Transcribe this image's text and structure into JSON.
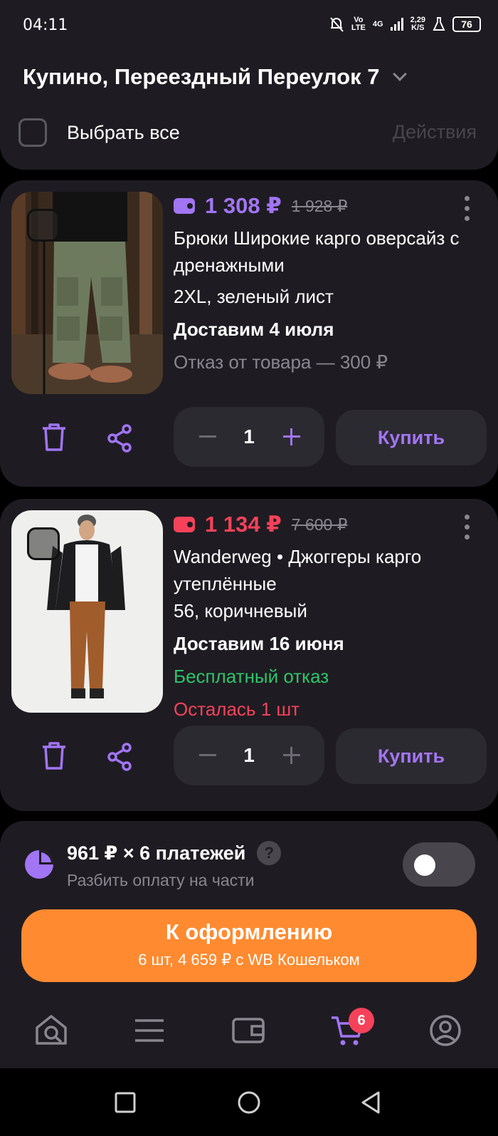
{
  "status_bar": {
    "time": "04:11",
    "network_volte": "Vo\nLTE",
    "network_type": "4G",
    "data_rate": "2,29\nK/S",
    "battery": "76"
  },
  "header": {
    "address": "Купино, Переездный Переулок 7",
    "select_all_label": "Выбрать все",
    "actions_label": "Действия"
  },
  "colors": {
    "wallet_purple": "#a275f4",
    "wallet_red": "#f5425a",
    "checkout_orange": "#ff8a30",
    "free_return_green": "#2fc46a"
  },
  "products": [
    {
      "price": "1 308 ₽",
      "old_price": "1 928 ₽",
      "price_color": "#a275f4",
      "title": "Брюки Широкие карго оверсайз с дренажными",
      "variant": "2XL, зеленый лист",
      "delivery": "Доставим 4 июля",
      "note": "Отказ от товара — 300 ₽",
      "quantity": "1",
      "buy_label": "Купить"
    },
    {
      "price": "1 134 ₽",
      "old_price": "7 600 ₽",
      "price_color": "#f5425a",
      "title": "Wanderweg • Джоггеры карго утеплённые",
      "variant": "56, коричневый",
      "delivery": "Доставим 16 июня",
      "note": "Бесплатный отказ",
      "stock": "Осталась 1 шт",
      "quantity": "1",
      "buy_label": "Купить"
    }
  ],
  "split_payment": {
    "title": "961 ₽ × 6 платежей",
    "help": "?",
    "subtitle": "Разбить оплату на части",
    "enabled": false
  },
  "checkout": {
    "title": "К оформлению",
    "subtitle": "6 шт, 4 659 ₽ с WB Кошельком"
  },
  "tabbar": {
    "cart_badge": "6",
    "tabs": [
      "home-search-icon",
      "catalog-menu-icon",
      "wallet-icon",
      "cart-icon",
      "profile-icon"
    ]
  }
}
